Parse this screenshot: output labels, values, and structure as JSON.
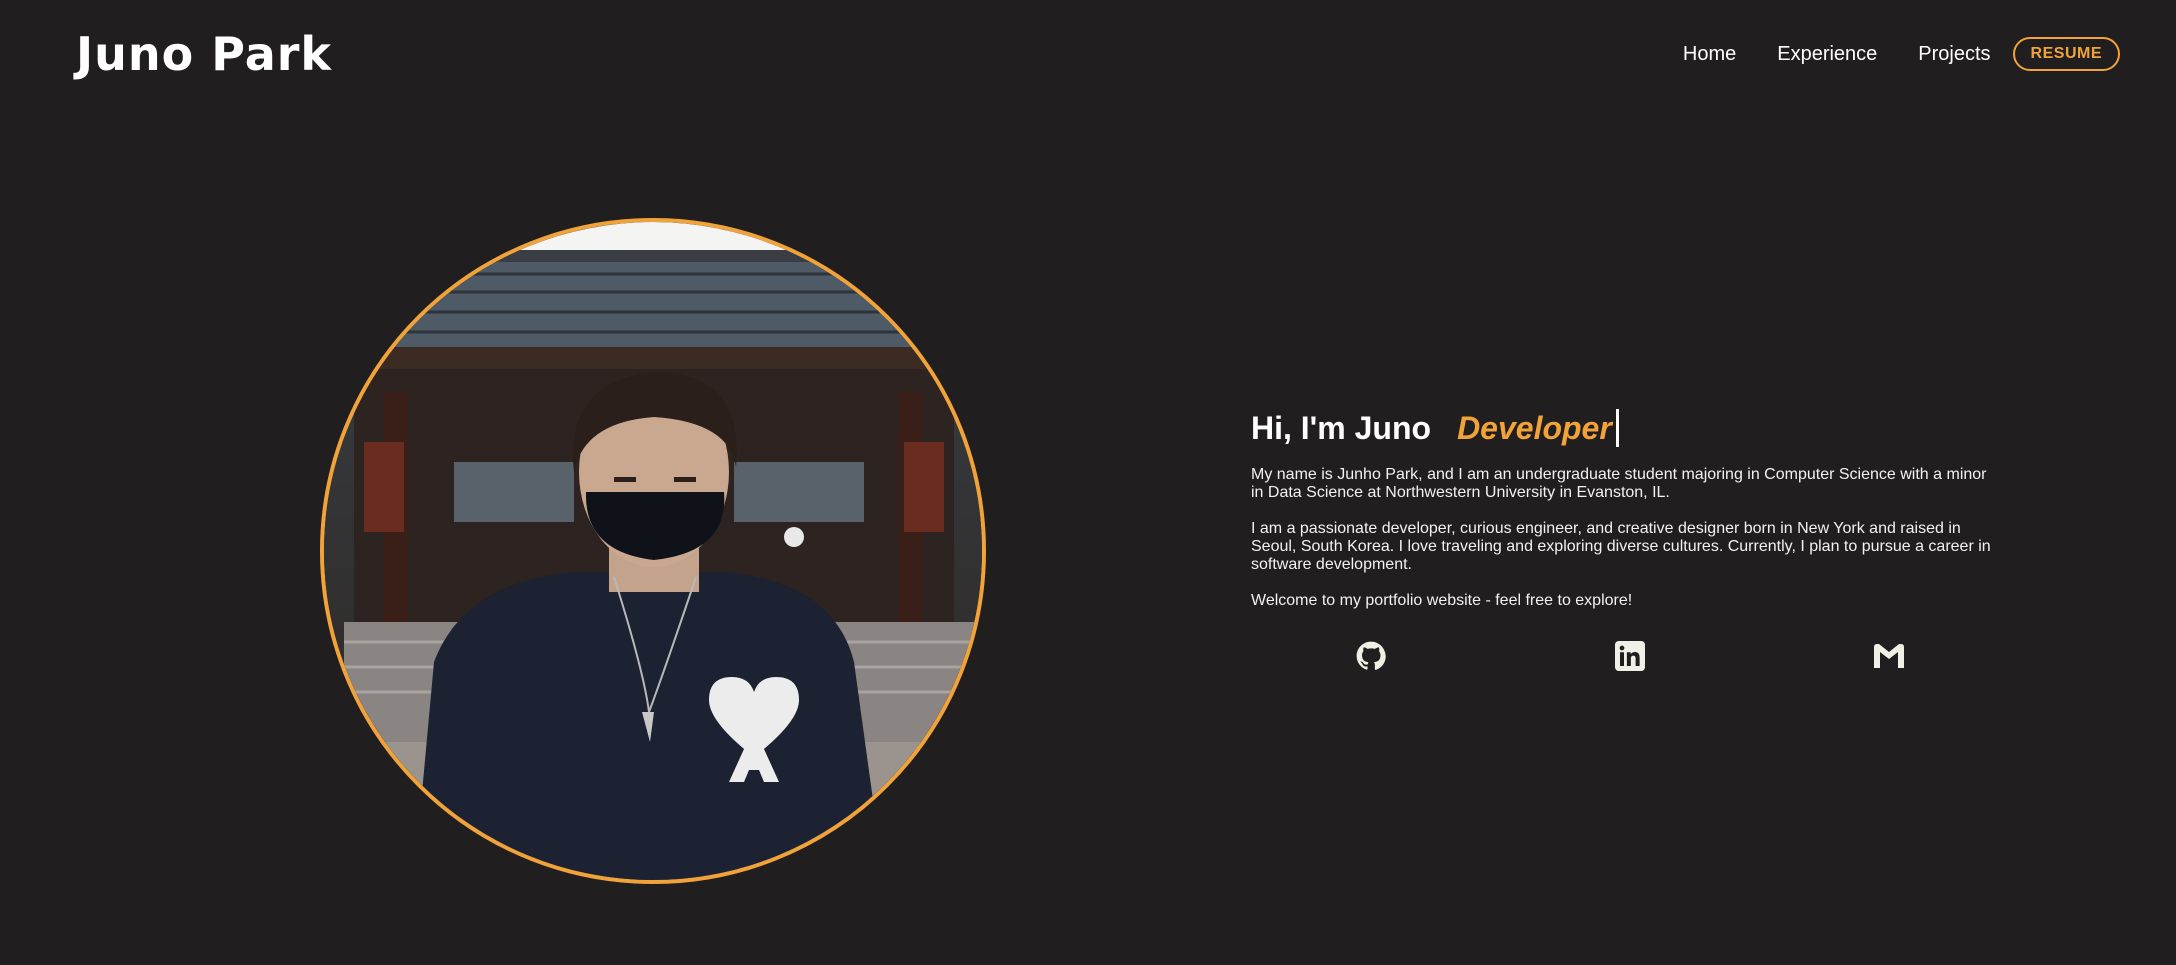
{
  "header": {
    "logo": "Juno Park",
    "nav": [
      "Home",
      "Experience",
      "Projects"
    ],
    "resume_label": "RESUME"
  },
  "colors": {
    "background": "#201e1f",
    "accent": "#f1a33a",
    "text": "#ffffff"
  },
  "intro": {
    "greeting": "Hi, I'm Juno",
    "role": "Developer",
    "paragraphs": [
      "My name is Junho Park, and I am an undergraduate student majoring in Computer Science with a minor in Data Science at Northwestern University in Evanston, IL.",
      "I am a passionate developer, curious engineer, and creative designer born in New York and raised in Seoul, South Korea. I love traveling and exploring diverse cultures. Currently, I plan to pursue a career in software development.",
      "Welcome to my portfolio website - feel free to explore!"
    ]
  },
  "socials": [
    "github-icon",
    "linkedin-icon",
    "gmail-icon"
  ]
}
